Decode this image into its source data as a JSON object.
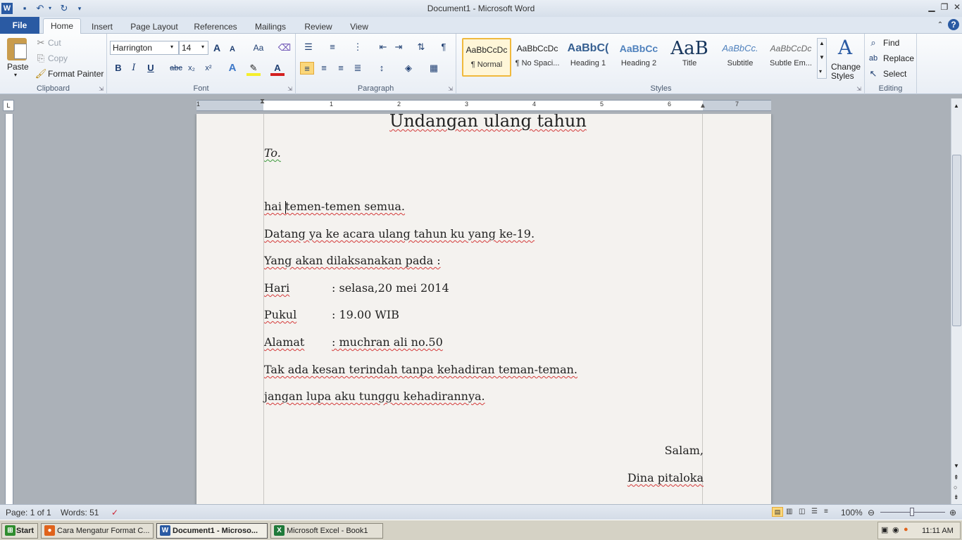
{
  "window": {
    "title": "Document1 - Microsoft Word"
  },
  "ribbon_tabs": [
    "File",
    "Home",
    "Insert",
    "Page Layout",
    "References",
    "Mailings",
    "Review",
    "View"
  ],
  "clipboard": {
    "paste": "Paste",
    "cut": "Cut",
    "copy": "Copy",
    "format_painter": "Format Painter",
    "label": "Clipboard"
  },
  "font": {
    "family": "Harrington",
    "size": "14",
    "label": "Font",
    "bold": "B",
    "italic": "I",
    "underline": "U",
    "strikethrough": "abc",
    "subscript": "x₂",
    "superscript": "x²",
    "grow": "A",
    "shrink": "A",
    "change_case": "Aa"
  },
  "paragraph": {
    "label": "Paragraph"
  },
  "styles": {
    "label": "Styles",
    "items": [
      {
        "preview": "AaBbCcDc",
        "name": "¶ Normal"
      },
      {
        "preview": "AaBbCcDc",
        "name": "¶ No Spaci..."
      },
      {
        "preview": "AaBbC(",
        "name": "Heading 1"
      },
      {
        "preview": "AaBbCc",
        "name": "Heading 2"
      },
      {
        "preview": "AaB",
        "name": "Title"
      },
      {
        "preview": "AaBbCc.",
        "name": "Subtitle"
      },
      {
        "preview": "AaBbCcDc",
        "name": "Subtle Em..."
      }
    ],
    "change_styles_1": "Change",
    "change_styles_2": "Styles"
  },
  "editing": {
    "label": "Editing",
    "find": "Find",
    "replace": "Replace",
    "select": "Select"
  },
  "ruler": {
    "numbers": [
      "1",
      "1",
      "2",
      "3",
      "4",
      "5",
      "6",
      "7"
    ]
  },
  "document": {
    "title": "Undangan ulang tahun",
    "to": "To.",
    "greeting": "hai temen-temen semua.",
    "line1": "Datang ya ke acara ulang tahun ku yang ke-19.",
    "line2": "Yang akan dilaksanakan pada :",
    "hari_label": "Hari",
    "hari_value": ": selasa,20 mei 2014",
    "pukul_label": "Pukul",
    "pukul_value": ": 19.00 WIB",
    "alamat_label": "Alamat",
    "alamat_value": ": muchran ali no.50",
    "line3": "Tak ada kesan terindah tanpa kehadiran teman-teman.",
    "line4": "jangan lupa aku tunggu kehadirannya.",
    "closing": "Salam,",
    "signature": "Dina pitaloka"
  },
  "statusbar": {
    "page": "Page: 1 of 1",
    "words": "Words: 51",
    "zoom": "100%"
  },
  "taskbar": {
    "start": "Start",
    "tasks": [
      "Cara Mengatur Format C...",
      "Document1 - Microso...",
      "Microsoft Excel - Book1"
    ],
    "clock": "11:11 AM"
  }
}
